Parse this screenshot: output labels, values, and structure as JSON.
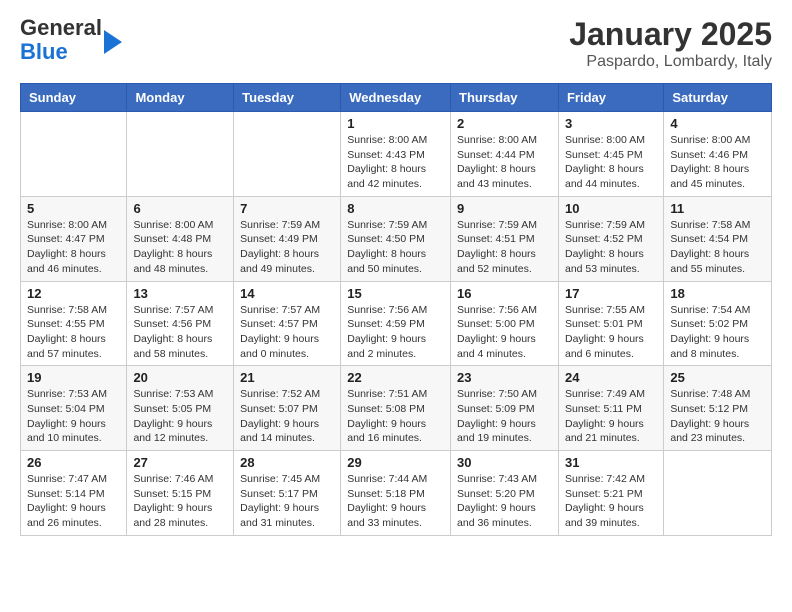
{
  "logo": {
    "line1": "General",
    "line2": "Blue"
  },
  "title": "January 2025",
  "subtitle": "Paspardo, Lombardy, Italy",
  "weekdays": [
    "Sunday",
    "Monday",
    "Tuesday",
    "Wednesday",
    "Thursday",
    "Friday",
    "Saturday"
  ],
  "weeks": [
    [
      {
        "day": "",
        "info": ""
      },
      {
        "day": "",
        "info": ""
      },
      {
        "day": "",
        "info": ""
      },
      {
        "day": "1",
        "info": "Sunrise: 8:00 AM\nSunset: 4:43 PM\nDaylight: 8 hours and 42 minutes."
      },
      {
        "day": "2",
        "info": "Sunrise: 8:00 AM\nSunset: 4:44 PM\nDaylight: 8 hours and 43 minutes."
      },
      {
        "day": "3",
        "info": "Sunrise: 8:00 AM\nSunset: 4:45 PM\nDaylight: 8 hours and 44 minutes."
      },
      {
        "day": "4",
        "info": "Sunrise: 8:00 AM\nSunset: 4:46 PM\nDaylight: 8 hours and 45 minutes."
      }
    ],
    [
      {
        "day": "5",
        "info": "Sunrise: 8:00 AM\nSunset: 4:47 PM\nDaylight: 8 hours and 46 minutes."
      },
      {
        "day": "6",
        "info": "Sunrise: 8:00 AM\nSunset: 4:48 PM\nDaylight: 8 hours and 48 minutes."
      },
      {
        "day": "7",
        "info": "Sunrise: 7:59 AM\nSunset: 4:49 PM\nDaylight: 8 hours and 49 minutes."
      },
      {
        "day": "8",
        "info": "Sunrise: 7:59 AM\nSunset: 4:50 PM\nDaylight: 8 hours and 50 minutes."
      },
      {
        "day": "9",
        "info": "Sunrise: 7:59 AM\nSunset: 4:51 PM\nDaylight: 8 hours and 52 minutes."
      },
      {
        "day": "10",
        "info": "Sunrise: 7:59 AM\nSunset: 4:52 PM\nDaylight: 8 hours and 53 minutes."
      },
      {
        "day": "11",
        "info": "Sunrise: 7:58 AM\nSunset: 4:54 PM\nDaylight: 8 hours and 55 minutes."
      }
    ],
    [
      {
        "day": "12",
        "info": "Sunrise: 7:58 AM\nSunset: 4:55 PM\nDaylight: 8 hours and 57 minutes."
      },
      {
        "day": "13",
        "info": "Sunrise: 7:57 AM\nSunset: 4:56 PM\nDaylight: 8 hours and 58 minutes."
      },
      {
        "day": "14",
        "info": "Sunrise: 7:57 AM\nSunset: 4:57 PM\nDaylight: 9 hours and 0 minutes."
      },
      {
        "day": "15",
        "info": "Sunrise: 7:56 AM\nSunset: 4:59 PM\nDaylight: 9 hours and 2 minutes."
      },
      {
        "day": "16",
        "info": "Sunrise: 7:56 AM\nSunset: 5:00 PM\nDaylight: 9 hours and 4 minutes."
      },
      {
        "day": "17",
        "info": "Sunrise: 7:55 AM\nSunset: 5:01 PM\nDaylight: 9 hours and 6 minutes."
      },
      {
        "day": "18",
        "info": "Sunrise: 7:54 AM\nSunset: 5:02 PM\nDaylight: 9 hours and 8 minutes."
      }
    ],
    [
      {
        "day": "19",
        "info": "Sunrise: 7:53 AM\nSunset: 5:04 PM\nDaylight: 9 hours and 10 minutes."
      },
      {
        "day": "20",
        "info": "Sunrise: 7:53 AM\nSunset: 5:05 PM\nDaylight: 9 hours and 12 minutes."
      },
      {
        "day": "21",
        "info": "Sunrise: 7:52 AM\nSunset: 5:07 PM\nDaylight: 9 hours and 14 minutes."
      },
      {
        "day": "22",
        "info": "Sunrise: 7:51 AM\nSunset: 5:08 PM\nDaylight: 9 hours and 16 minutes."
      },
      {
        "day": "23",
        "info": "Sunrise: 7:50 AM\nSunset: 5:09 PM\nDaylight: 9 hours and 19 minutes."
      },
      {
        "day": "24",
        "info": "Sunrise: 7:49 AM\nSunset: 5:11 PM\nDaylight: 9 hours and 21 minutes."
      },
      {
        "day": "25",
        "info": "Sunrise: 7:48 AM\nSunset: 5:12 PM\nDaylight: 9 hours and 23 minutes."
      }
    ],
    [
      {
        "day": "26",
        "info": "Sunrise: 7:47 AM\nSunset: 5:14 PM\nDaylight: 9 hours and 26 minutes."
      },
      {
        "day": "27",
        "info": "Sunrise: 7:46 AM\nSunset: 5:15 PM\nDaylight: 9 hours and 28 minutes."
      },
      {
        "day": "28",
        "info": "Sunrise: 7:45 AM\nSunset: 5:17 PM\nDaylight: 9 hours and 31 minutes."
      },
      {
        "day": "29",
        "info": "Sunrise: 7:44 AM\nSunset: 5:18 PM\nDaylight: 9 hours and 33 minutes."
      },
      {
        "day": "30",
        "info": "Sunrise: 7:43 AM\nSunset: 5:20 PM\nDaylight: 9 hours and 36 minutes."
      },
      {
        "day": "31",
        "info": "Sunrise: 7:42 AM\nSunset: 5:21 PM\nDaylight: 9 hours and 39 minutes."
      },
      {
        "day": "",
        "info": ""
      }
    ]
  ]
}
